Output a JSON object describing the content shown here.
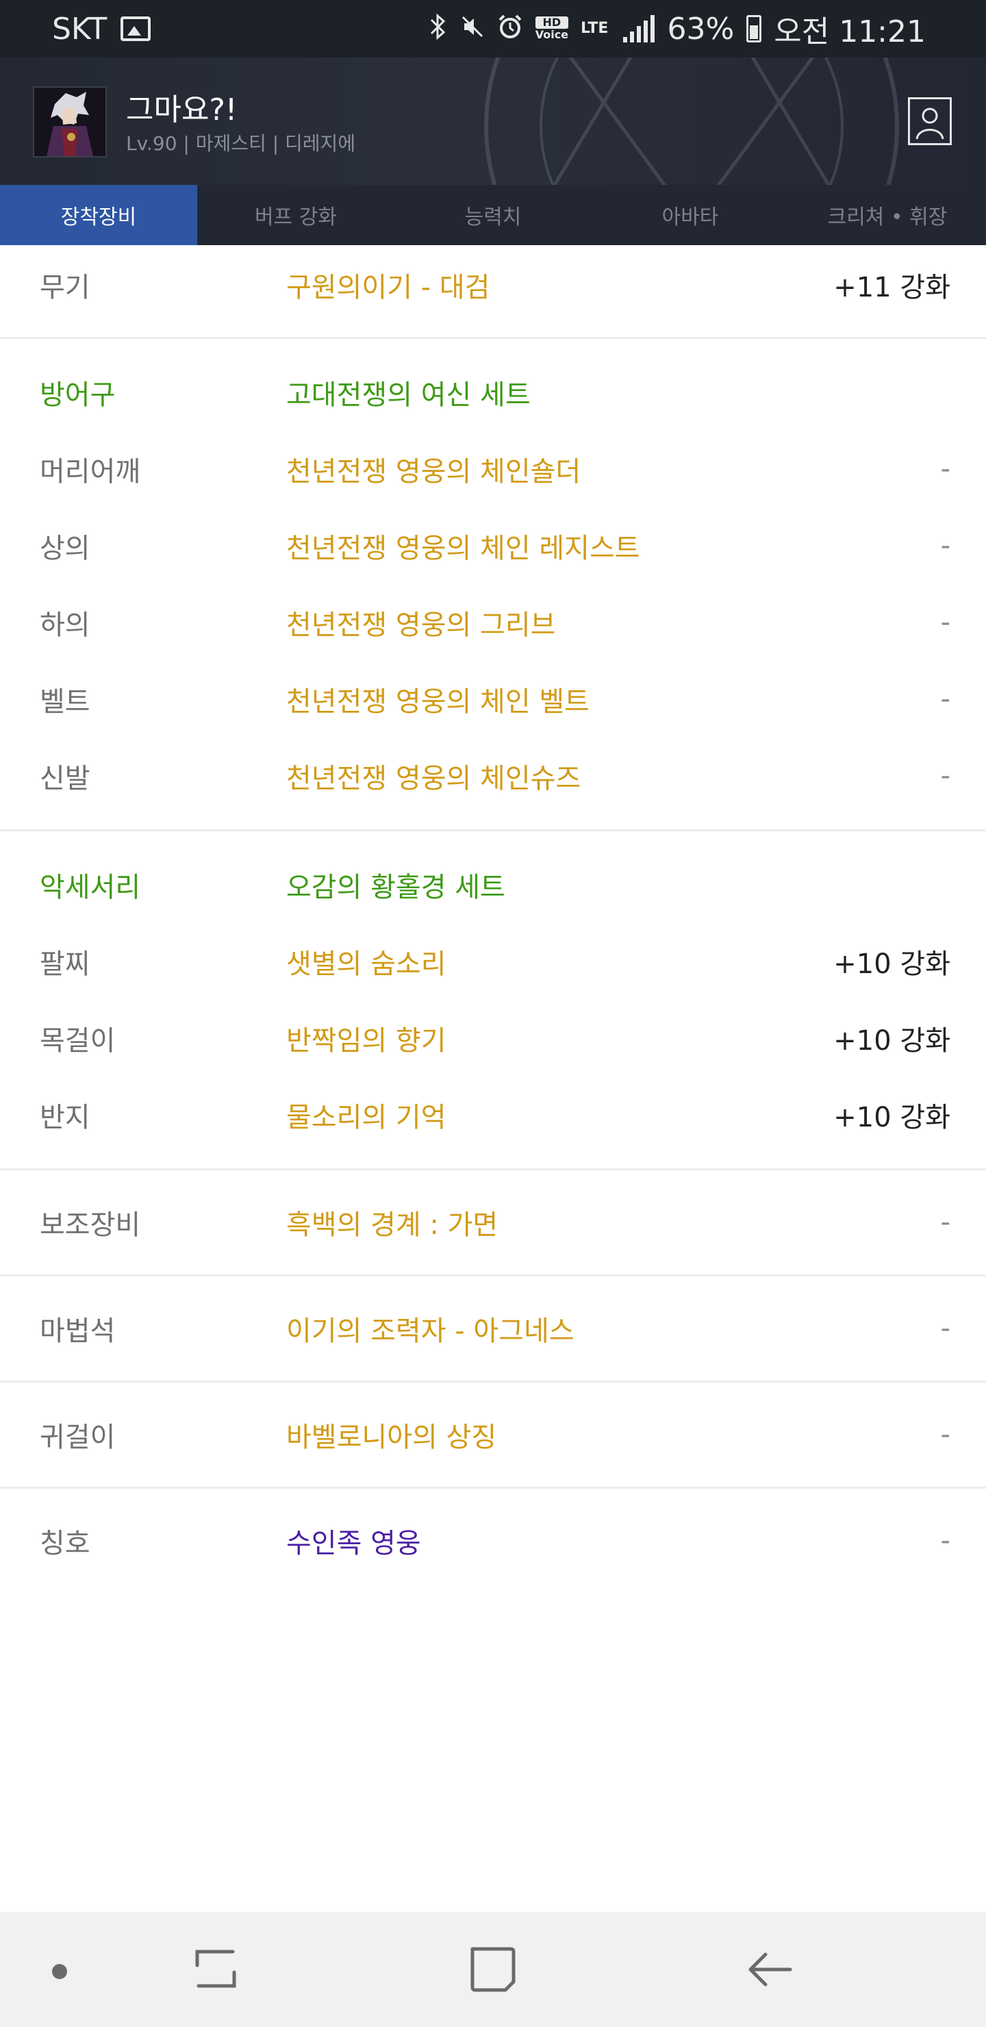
{
  "status_bar": {
    "carrier": "SKT",
    "battery": "63%",
    "time": "오전 11:21",
    "hd_label": "HD",
    "voice_label": "Voice",
    "lte_label": "LTE"
  },
  "profile": {
    "name": "그마요?!",
    "info": "Lv.90 | 마제스티 | 디레지에"
  },
  "tabs": [
    {
      "label": "장착장비",
      "active": true
    },
    {
      "label": "버프 강화",
      "active": false
    },
    {
      "label": "능력치",
      "active": false
    },
    {
      "label": "아바타",
      "active": false
    },
    {
      "label": "크리쳐 • 휘장",
      "active": false
    }
  ],
  "equipment": {
    "weapon": {
      "slot": "무기",
      "item": "구원의이기 - 대검",
      "value": "+11 강화"
    },
    "armor": {
      "slot": "방어구",
      "set": "고대전쟁의 여신 세트",
      "rows": [
        {
          "slot": "머리어깨",
          "item": "천년전쟁 영웅의 체인숄더",
          "value": "-"
        },
        {
          "slot": "상의",
          "item": "천년전쟁 영웅의 체인 레지스트",
          "value": "-"
        },
        {
          "slot": "하의",
          "item": "천년전쟁 영웅의 그리브",
          "value": "-"
        },
        {
          "slot": "벨트",
          "item": "천년전쟁 영웅의 체인 벨트",
          "value": "-"
        },
        {
          "slot": "신발",
          "item": "천년전쟁 영웅의 체인슈즈",
          "value": "-"
        }
      ]
    },
    "accessory": {
      "slot": "악세서리",
      "set": "오감의 황홀경 세트",
      "rows": [
        {
          "slot": "팔찌",
          "item": "샛별의 숨소리",
          "value": "+10 강화"
        },
        {
          "slot": "목걸이",
          "item": "반짝임의 향기",
          "value": "+10 강화"
        },
        {
          "slot": "반지",
          "item": "물소리의 기억",
          "value": "+10 강화"
        }
      ]
    },
    "sub_equip": {
      "slot": "보조장비",
      "item": "흑백의 경계 : 가면",
      "value": "-"
    },
    "magic_stone": {
      "slot": "마법석",
      "item": "이기의 조력자 - 아그네스",
      "value": "-"
    },
    "earring": {
      "slot": "귀걸이",
      "item": "바벨로니아의 상징",
      "value": "-"
    },
    "title": {
      "slot": "칭호",
      "item": "수인족 영웅",
      "value": "-"
    }
  },
  "colors": {
    "item_gold": "#d29a16",
    "set_green": "#3e9a16",
    "title_purple": "#4b1fa6",
    "tab_active": "#2e56a3"
  },
  "icons": [
    "image-icon",
    "bluetooth-icon",
    "mute-icon",
    "alarm-icon",
    "signal-icon",
    "battery-icon",
    "profile-icon",
    "nav-dot-icon",
    "recent-apps-icon",
    "home-icon",
    "back-icon"
  ]
}
